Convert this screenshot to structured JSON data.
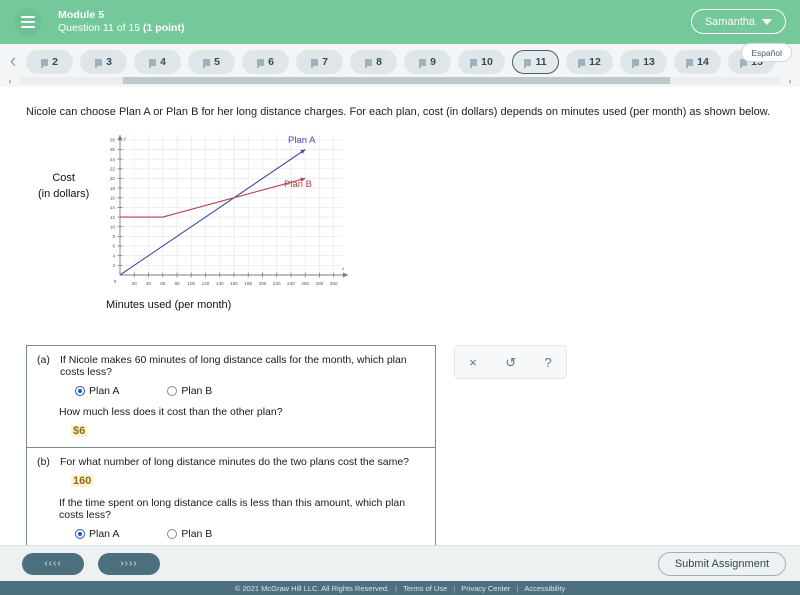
{
  "header": {
    "menu_icon": "hamburger-icon",
    "module": "Module 5",
    "question_label": "Question 11 of 15 ",
    "question_points": "(1 point)",
    "user_name": "Samantha",
    "user_caret_icon": "chevron-down-icon",
    "bg_color": "#74c89a"
  },
  "qnav": {
    "prev_icon": "chevron-left-icon",
    "next_icon": "chevron-right-icon",
    "scroll_left_icon": "chevron-left-small-icon",
    "scroll_right_icon": "chevron-right-small-icon",
    "espanol_label": "Español",
    "current": "11",
    "pills": [
      {
        "label": "2"
      },
      {
        "label": "3"
      },
      {
        "label": "4"
      },
      {
        "label": "5"
      },
      {
        "label": "6"
      },
      {
        "label": "7"
      },
      {
        "label": "8"
      },
      {
        "label": "9"
      },
      {
        "label": "10"
      },
      {
        "label": "11"
      },
      {
        "label": "12"
      },
      {
        "label": "13"
      },
      {
        "label": "14"
      },
      {
        "label": "15"
      }
    ]
  },
  "main": {
    "prompt": "Nicole can choose Plan A or Plan B for her long distance charges. For each plan, cost (in dollars) depends on minutes used (per month) as shown below."
  },
  "chart_data": {
    "type": "line",
    "title": "",
    "xlabel": "Minutes used (per month)",
    "ylabel": "Cost\n(in dollars)",
    "ylabel_line1": "Cost",
    "ylabel_line2": "(in dollars)",
    "xlim": [
      0,
      320
    ],
    "ylim": [
      0,
      29
    ],
    "xticks": [
      0,
      20,
      40,
      60,
      80,
      100,
      120,
      140,
      160,
      180,
      200,
      220,
      240,
      260,
      280,
      300
    ],
    "yticks": [
      0,
      2,
      4,
      6,
      8,
      10,
      12,
      14,
      16,
      18,
      20,
      22,
      24,
      26,
      28
    ],
    "grid": true,
    "legend": "inline-labels",
    "x_axis_symbol": "x",
    "y_axis_symbol": "y",
    "series": [
      {
        "name": "Plan A",
        "color": "#4a4aa8",
        "points": [
          [
            0,
            0
          ],
          [
            260,
            26
          ]
        ],
        "label": "Plan A",
        "arrow": true
      },
      {
        "name": "Plan B",
        "color": "#b2434a",
        "points": [
          [
            0,
            12
          ],
          [
            60,
            12
          ],
          [
            260,
            20
          ]
        ],
        "label": "Plan B",
        "arrow": true
      }
    ]
  },
  "answers": {
    "parts": [
      {
        "tag": "(a)",
        "question": "If Nicole makes 60 minutes of long distance calls for the month, which plan costs less?",
        "options": [
          {
            "label": "Plan A",
            "checked": true
          },
          {
            "label": "Plan B",
            "checked": false
          }
        ],
        "subquestion": "How much less does it cost than the other plan?",
        "value": "$6"
      },
      {
        "tag": "(b)",
        "question": "For what number of long distance minutes do the two plans cost the same?",
        "value": "160",
        "subquestion": "If the time spent on long distance calls is less than this amount, which plan costs less?",
        "options": [
          {
            "label": "Plan A",
            "checked": true
          },
          {
            "label": "Plan B",
            "checked": false
          }
        ]
      }
    ]
  },
  "toolbar": {
    "clear_icon": "close-x-icon",
    "undo_icon": "undo-arrow-icon",
    "help_icon": "question-mark-icon",
    "clear_label": "×",
    "undo_label": "↺",
    "help_label": "?"
  },
  "bottom": {
    "prev_label": "‹‹‹‹",
    "next_label": "››››",
    "submit_label": "Submit Assignment"
  },
  "footer": {
    "copyright": "© 2021 McGraw Hill LLC. All Rights Reserved.",
    "links": [
      "Terms of Use",
      "Privacy Center",
      "Accessibility"
    ],
    "separator": "|"
  }
}
